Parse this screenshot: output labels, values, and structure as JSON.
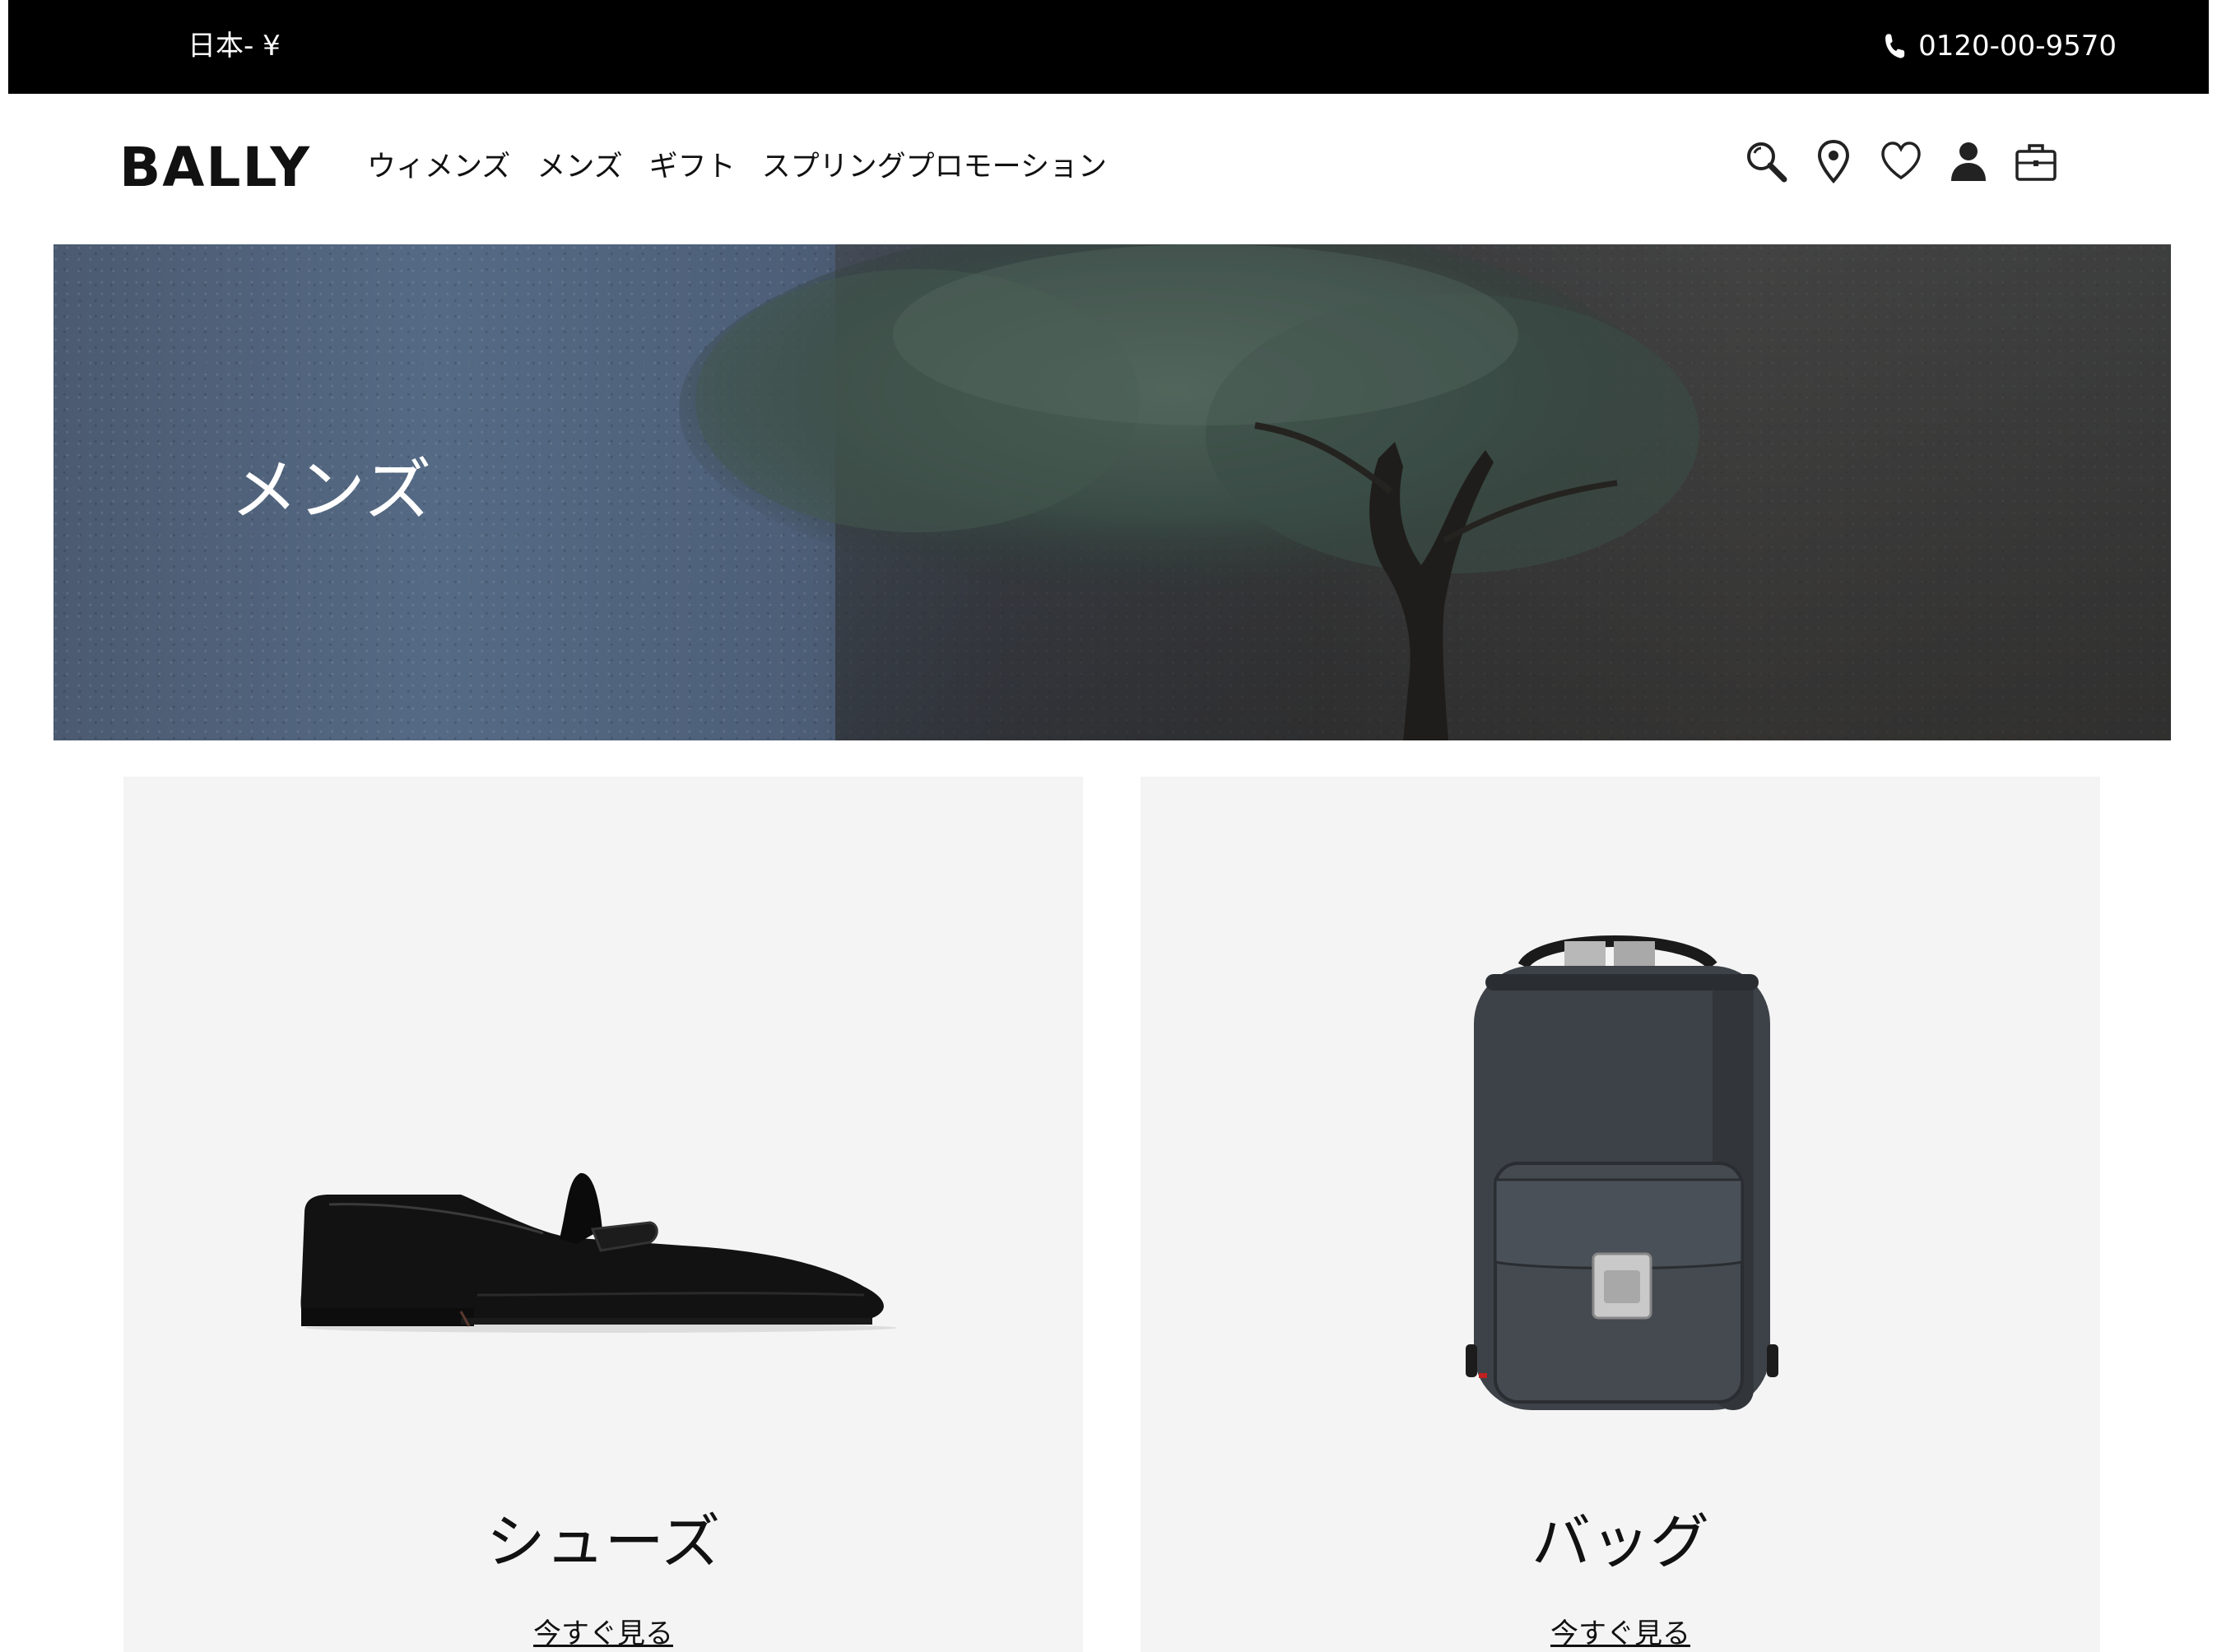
{
  "topbar": {
    "region_label": "日本- ¥",
    "phone_number": "0120-00-9570",
    "phone_icon": "phone-icon"
  },
  "header": {
    "logo": "BALLY",
    "nav": [
      {
        "label": "ウィメンズ"
      },
      {
        "label": "メンズ"
      },
      {
        "label": "ギフト"
      },
      {
        "label": "スプリングプロモーション"
      }
    ],
    "icons": [
      "search-icon",
      "store-locator-icon",
      "wishlist-heart-icon",
      "account-icon",
      "bag-icon"
    ]
  },
  "hero": {
    "title": "メンズ"
  },
  "categories": [
    {
      "label": "シューズ",
      "cta": "今すぐ見る",
      "image": "loafer-shoe"
    },
    {
      "label": "バッグ",
      "cta": "今すぐ見る",
      "image": "backpack"
    }
  ],
  "colors": {
    "topbar_bg": "#000000",
    "card_bg": "#f4f4f4",
    "text": "#111111"
  }
}
